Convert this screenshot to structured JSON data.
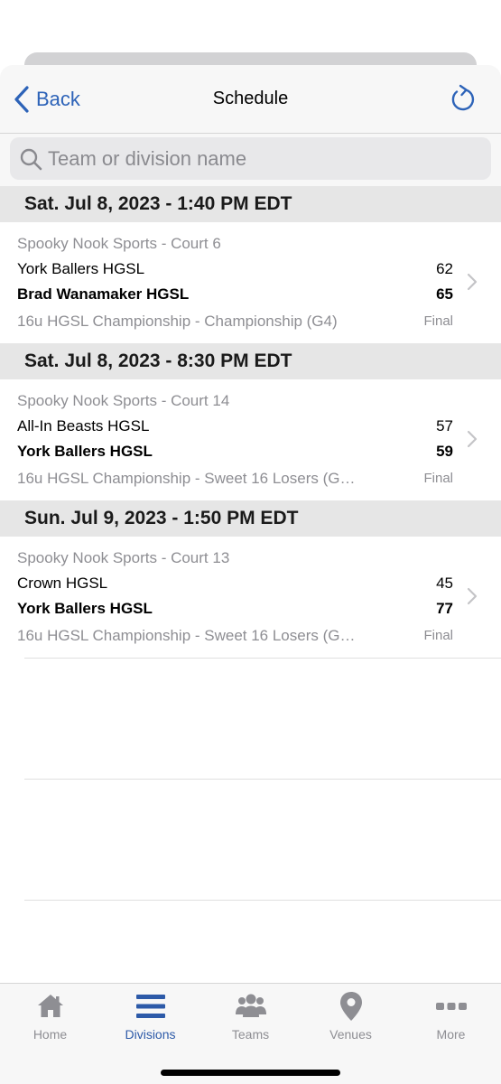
{
  "colors": {
    "accent": "#2d63b8",
    "tab_active": "#2d5aa8",
    "muted_text": "#8e8e93",
    "header_bg": "#e6e6e6"
  },
  "navbar": {
    "back_label": "Back",
    "title": "Schedule",
    "back_icon": "chevron-left-icon",
    "refresh_icon": "refresh-icon"
  },
  "search": {
    "value": "",
    "placeholder": "Team or division name",
    "icon": "search-icon"
  },
  "schedule": [
    {
      "date_header": "Sat. Jul 8, 2023 - 1:40 PM EDT",
      "venue": "Spooky Nook Sports - Court 6",
      "team1": "York Ballers HGSL",
      "score1": "62",
      "team2": "Brad Wanamaker HGSL",
      "score2": "65",
      "division": "16u HGSL Championship - Championship (G4)",
      "status": "Final"
    },
    {
      "date_header": "Sat. Jul 8, 2023 - 8:30 PM EDT",
      "venue": "Spooky Nook Sports - Court 14",
      "team1": "All-In Beasts HGSL",
      "score1": "57",
      "team2": "York Ballers HGSL",
      "score2": "59",
      "division": "16u HGSL Championship - Sweet 16 Losers (G…",
      "status": "Final"
    },
    {
      "date_header": "Sun. Jul 9, 2023 - 1:50 PM EDT",
      "venue": "Spooky Nook Sports - Court 13",
      "team1": "Crown HGSL",
      "score1": "45",
      "team2": "York Ballers HGSL",
      "score2": "77",
      "division": "16u HGSL Championship - Sweet 16 Losers (G…",
      "status": "Final"
    }
  ],
  "tabbar": {
    "items": [
      {
        "label": "Home",
        "icon": "home-icon",
        "active": false
      },
      {
        "label": "Divisions",
        "icon": "list-icon",
        "active": true
      },
      {
        "label": "Teams",
        "icon": "people-icon",
        "active": false
      },
      {
        "label": "Venues",
        "icon": "map-pin-icon",
        "active": false
      },
      {
        "label": "More",
        "icon": "more-dots-icon",
        "active": false
      }
    ]
  }
}
